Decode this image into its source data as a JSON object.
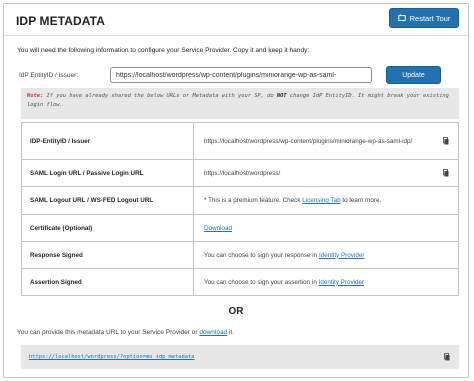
{
  "header": {
    "title": "IDP METADATA",
    "restart_label": "Restart Tour"
  },
  "intro": "You will need the following information to configure your Service Provider. Copy it and keep it handy:",
  "entity": {
    "label": "IdP EntityID / Issuer:",
    "value": "https://localhost/wordpress/wp-content/plugins/miniorange-wp-as-saml-",
    "update_label": "Update"
  },
  "note": {
    "prefix": "Note:",
    "text_before": " If you have already shared the below URLs or Metadata with your SP, do ",
    "emph": "NOT",
    "text_after": " change IdP EntityID. It might break your existing login flow."
  },
  "table": {
    "entity_key": "IDP-EntityID / Issuer",
    "entity_value": "https://localhost/wordpress/wp-content/plugins/miniorange-wp-as-saml-idp/",
    "login_key": "SAML Login URL / Passive Login URL",
    "login_value": "https://localhost/wordpress/",
    "logout_key": "SAML Logout URL / WS-FED Logout URL",
    "logout_text": "* This is a premium feature. Check ",
    "logout_link": "Licensing Tab",
    "logout_after": " to learn more.",
    "cert_key": "Certificate (Optional)",
    "cert_link": "Download",
    "resp_key": "Response Signed",
    "resp_text": "You can choose to sign your response in ",
    "resp_link": "Identity Provider",
    "assert_key": "Assertion Signed",
    "assert_text": "You can choose to sign your assertion in ",
    "assert_link": "Identity Provider"
  },
  "or_label": "OR",
  "provide": {
    "text": "You can provide this metadata URL to your Service Provider or ",
    "link": "download",
    "after": " it."
  },
  "metadata_url": "https://localhost/wordpress/?option=mo_idp_metadata",
  "icons": {
    "restart": "restart-icon",
    "copy": "copy-icon"
  },
  "colors": {
    "primary": "#2271b1",
    "note_red": "#d63638",
    "box_bg": "#e7e7e7"
  }
}
